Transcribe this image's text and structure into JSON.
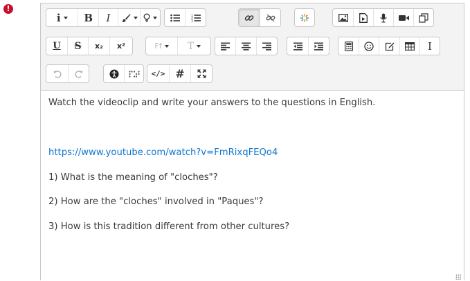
{
  "error": {
    "symbol": "!"
  },
  "toolbar": {
    "row1": [
      {
        "name": "info-menu-button",
        "label": "i",
        "dropdown": true
      },
      {
        "name": "bold-button",
        "label": "B"
      },
      {
        "name": "italic-button",
        "label": "I"
      },
      {
        "name": "style-brush-button",
        "dropdown": true
      },
      {
        "name": "lightbulb-button",
        "dropdown": true
      },
      {
        "name": "unordered-list-button"
      },
      {
        "name": "ordered-list-button"
      },
      {
        "name": "link-button"
      },
      {
        "name": "unlink-button"
      },
      {
        "name": "special-chars-button"
      },
      {
        "name": "image-button"
      },
      {
        "name": "media-button"
      },
      {
        "name": "record-audio-button"
      },
      {
        "name": "record-video-button"
      },
      {
        "name": "manage-files-button"
      }
    ],
    "row2": [
      {
        "name": "underline-button",
        "label": "U"
      },
      {
        "name": "strikethrough-button",
        "label": "S"
      },
      {
        "name": "subscript-button",
        "label": "x₂"
      },
      {
        "name": "superscript-button",
        "label": "x²"
      },
      {
        "name": "font-family-button",
        "label": "Ff",
        "dropdown": true
      },
      {
        "name": "font-size-button",
        "label": "T",
        "dropdown": true
      },
      {
        "name": "align-left-button"
      },
      {
        "name": "align-center-button"
      },
      {
        "name": "align-right-button"
      },
      {
        "name": "outdent-button"
      },
      {
        "name": "indent-button"
      },
      {
        "name": "equation-button"
      },
      {
        "name": "emoji-button"
      },
      {
        "name": "edit-button"
      },
      {
        "name": "table-button"
      },
      {
        "name": "clear-format-button",
        "label": "I"
      }
    ],
    "row3": [
      {
        "name": "undo-button"
      },
      {
        "name": "redo-button"
      },
      {
        "name": "accessibility-checker-button"
      },
      {
        "name": "screenreader-helper-button"
      },
      {
        "name": "html-button",
        "label": "</>"
      },
      {
        "name": "hashtag-button",
        "label": "#"
      },
      {
        "name": "fullscreen-button"
      }
    ]
  },
  "content": {
    "line1": "Watch the videoclip and write your answers to the questions in English.",
    "link": "https://www.youtube.com/watch?v=FmRixqFEQo4",
    "q1": "1) What is the meaning of \"cloches\"?",
    "q2": "2) How are the \"cloches\" involved in \"Paques\"?",
    "q3": "3) How is this tradition different from other cultures?"
  },
  "colors": {
    "error": "#c8102e",
    "link": "#1177d1",
    "text": "#373a3c",
    "toolbar_bg": "#f3f3f3"
  }
}
